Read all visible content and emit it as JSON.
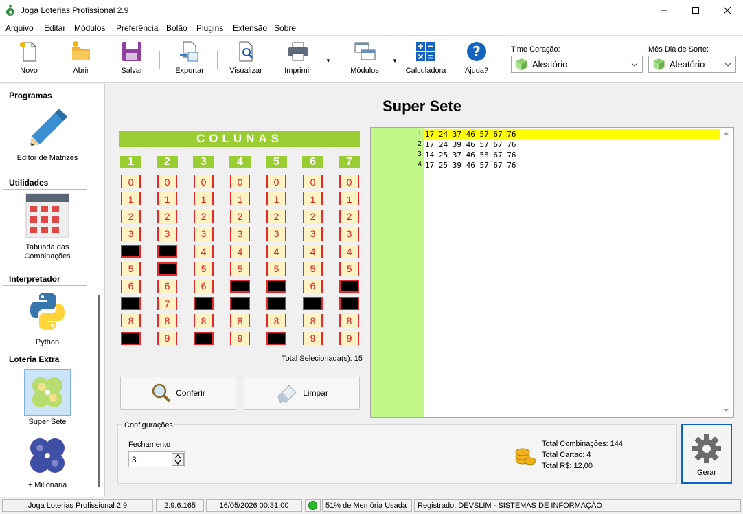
{
  "window": {
    "title": "Joga Loterias Profissional 2.9"
  },
  "menu": [
    "Arquivo",
    "Editar",
    "Módulos",
    "Preferência",
    "Bolão",
    "Plugins",
    "Extensão",
    "Sobre"
  ],
  "toolbar": {
    "novo": "Novo",
    "abrir": "Abrir",
    "salvar": "Salvar",
    "exportar": "Exportar",
    "visualizar": "Visualizar",
    "imprimir": "Imprimir",
    "modulos": "Módulos",
    "calculadora": "Calculadora",
    "ajuda": "Ajuda?",
    "time_label": "Time Coração:",
    "time_value": "Aleatório",
    "mes_label": "Mês Dia de Sorte:",
    "mes_value": "Aleatório"
  },
  "sidebar": {
    "programas": "Programas",
    "editor": "Editor de  Matrizes",
    "utilidades": "Utilidades",
    "tabuada_1": "Tabuada das",
    "tabuada_2": "Combinações",
    "interpretador": "Interpretador",
    "python": "Python",
    "loteria_extra": "Loteria Extra",
    "super_sete": "Super Sete",
    "milionaria": "+ Milionária"
  },
  "main": {
    "title": "Super Sete",
    "colunas_label": "COLUNAS",
    "columns": [
      "1",
      "2",
      "3",
      "4",
      "5",
      "6",
      "7"
    ],
    "digits": [
      "0",
      "1",
      "2",
      "3",
      "4",
      "5",
      "6",
      "7",
      "8",
      "9"
    ],
    "selected": {
      "1": [
        "4",
        "7",
        "9"
      ],
      "2": [
        "4",
        "5"
      ],
      "3": [
        "7",
        "9"
      ],
      "4": [
        "6",
        "7"
      ],
      "5": [
        "6",
        "7",
        "9"
      ],
      "6": [
        "7"
      ],
      "7": [
        "6",
        "7"
      ]
    },
    "total_selected": "Total Selecionada(s): 15",
    "conferir": "Conferir",
    "limpar": "Limpar"
  },
  "results": {
    "line_numbers": [
      "1",
      "2",
      "3",
      "4"
    ],
    "lines": [
      "17 24 37 46 57 67 76",
      "17 24 39 46 57 67 76",
      "14 25 37 46 56 67 76",
      "17 25 39 46 57 67 76"
    ]
  },
  "config": {
    "legend": "Configurações",
    "fechamento_label": "Fechamento",
    "fechamento_value": "3",
    "total_combinacoes": "Total Combinações: 144",
    "total_cartao": "Total Cartao: 4",
    "total_rs": "Total R$: 12,00",
    "gerar": "Gerar"
  },
  "status": {
    "app": "Joga Loterias Profissional 2.9",
    "version": "2.9.6.165",
    "datetime": "16/05/2026 00:31:00",
    "memory": "51% de Memória Usada",
    "registered": "Registrado: DEVSLIM - SISTEMAS DE INFORMAÇÃO"
  },
  "colors": {
    "accent_green": "#9acd32",
    "gutter_green": "#c2f78a",
    "highlight": "#ffff00",
    "cell_bg": "#fff3c4",
    "cell_red": "#e32b2b"
  }
}
